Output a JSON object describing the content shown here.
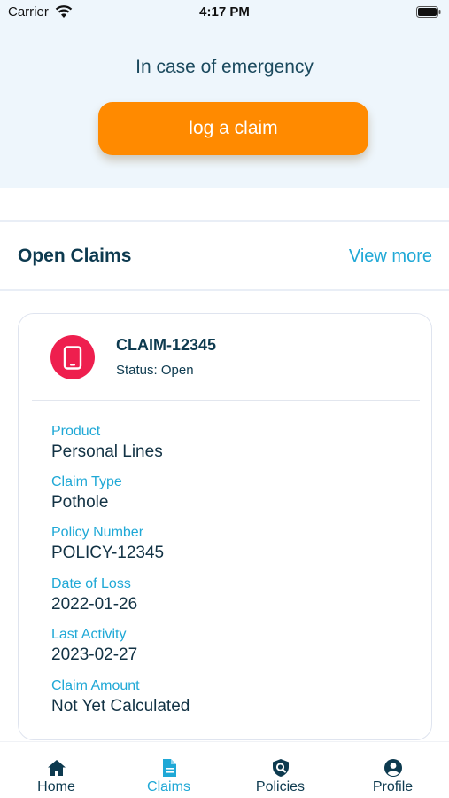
{
  "status_bar": {
    "carrier": "Carrier",
    "time": "4:17 PM"
  },
  "emergency": {
    "prompt": "In case of emergency",
    "button_label": "log a claim"
  },
  "open_claims": {
    "title": "Open Claims",
    "view_more": "View more"
  },
  "claim": {
    "id": "CLAIM-12345",
    "status": "Status: Open",
    "fields": [
      {
        "label": "Product",
        "value": "Personal Lines"
      },
      {
        "label": "Claim Type",
        "value": "Pothole"
      },
      {
        "label": "Policy Number",
        "value": "POLICY-12345"
      },
      {
        "label": "Date of Loss",
        "value": "2022-01-26"
      },
      {
        "label": "Last Activity",
        "value": "2023-02-27"
      },
      {
        "label": "Claim Amount",
        "value": "Not Yet Calculated"
      }
    ],
    "icon": "mobile-phone-icon"
  },
  "nav": {
    "items": [
      {
        "label": "Home",
        "icon": "home-icon"
      },
      {
        "label": "Claims",
        "icon": "document-icon",
        "active": true
      },
      {
        "label": "Policies",
        "icon": "shield-search-icon"
      },
      {
        "label": "Profile",
        "icon": "person-icon"
      }
    ]
  },
  "colors": {
    "accent": "#1fa8d6",
    "primary_button": "#ff8a00",
    "avatar": "#ee1f4e",
    "header_bg": "#eef6fc",
    "dark_text": "#0d3a4f"
  }
}
